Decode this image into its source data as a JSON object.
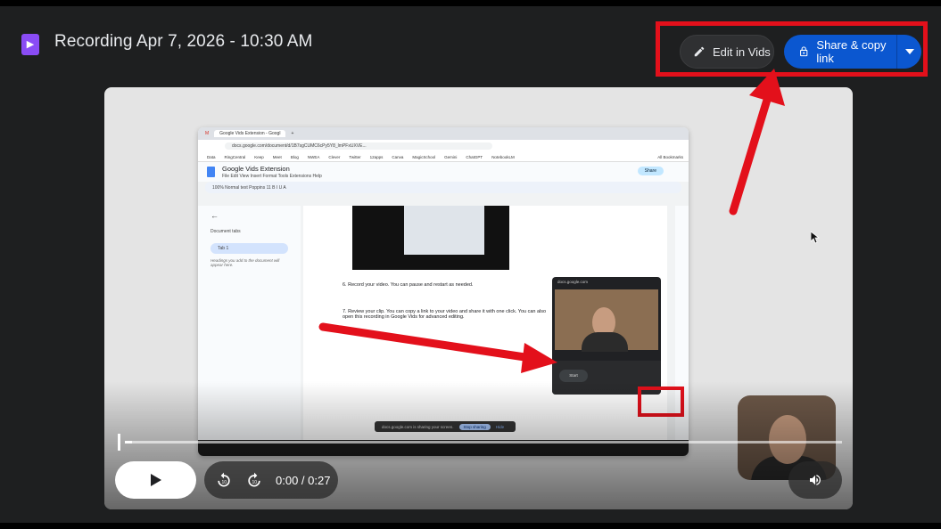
{
  "header": {
    "app_icon": "vids-play-icon",
    "title": "Recording Apr 7, 2026 - 10:30 AM",
    "edit_label": "Edit in Vids",
    "share_label": "Share & copy link"
  },
  "recording": {
    "browser_tab": "Google Vids Extension - Googl",
    "url": "docs.google.com/document/d/1B7sgCUMC6cPy5Y8_lmPFxUXVE...",
    "bookmarks": [
      "Data",
      "RingCentral",
      "Keep",
      "Meet",
      "Blog",
      "NWEA",
      "Clever",
      "Twitter",
      "12apps",
      "Canva",
      "MagicSchool",
      "Gemini",
      "ChatGPT",
      "NotebookLM"
    ],
    "bookmarks_all": "All Bookmarks",
    "doc_title": "Google Vids Extension",
    "doc_menu": "File  Edit  View  Insert  Format  Tools  Extensions  Help",
    "doc_share": "Share",
    "toolbar_text": "100%  Normal text  Poppins  11  B  I  U  A",
    "panel_heading": "Document tabs",
    "panel_tab": "Tab 1",
    "panel_hint": "Headings you add to the document will appear here.",
    "step6": "6.  Record your video. You can pause and restart as needed.",
    "step7": "7.  Review your clip. You can copy a link to your video and share it with one click. You can also open this recording in Google Vids for advanced editing.",
    "minirec_url": "docs.google.com",
    "minirec_start": "Start",
    "sharing_text": "docs.google.com is sharing your screen.",
    "stop_sharing": "Stop sharing",
    "hide": "Hide"
  },
  "player": {
    "progress": 0.01,
    "time": "0:00 / 0:27"
  },
  "colors": {
    "accent": "#0b57d0",
    "highlight": "#e3101b",
    "vids": "#8a4cf5"
  }
}
